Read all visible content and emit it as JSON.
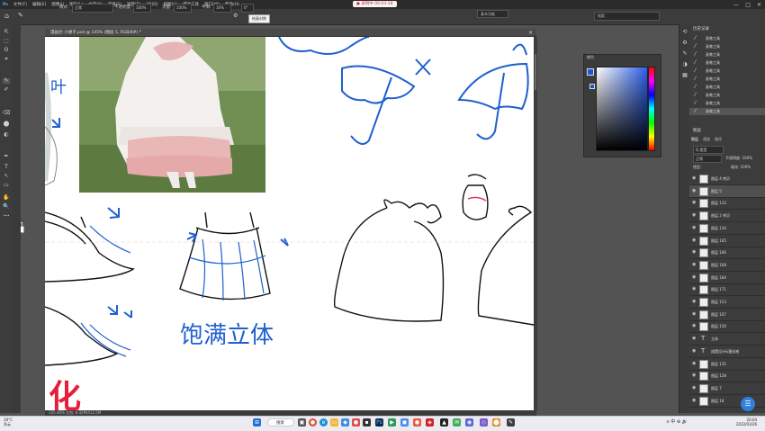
{
  "menu": {
    "items": [
      "文件(F)",
      "编辑(E)",
      "图像(I)",
      "图层(L)",
      "文字(Y)",
      "选择(S)",
      "滤镜(T)",
      "3D(D)",
      "视图(V)",
      "增效工具",
      "窗口(W)",
      "帮助(H)"
    ],
    "recording": "● 录制中 00:03:18",
    "win_controls": [
      "—",
      "□",
      "✕"
    ]
  },
  "options": {
    "mode_label": "模式:",
    "mode_value": "正常",
    "opacity_label": "不透明度:",
    "opacity_value": "100%",
    "flow_label": "流量:",
    "flow_value": "100%",
    "smooth_label": "平滑:",
    "smooth_value": "10%",
    "angle_value": "0°",
    "tooltip": "绘画对称",
    "workspace": "基本功能",
    "search": "搜索"
  },
  "toolbar": {
    "tools": [
      "⇱",
      "⬚",
      "ʘ",
      "⌗",
      "✎",
      "✐",
      "⌫",
      "⬤",
      "◐",
      "✒",
      "T",
      "↖",
      "▭",
      "✋",
      "🔍",
      "•••"
    ],
    "fg_color": "#1a55d6",
    "bg_color": "#ffffff"
  },
  "document": {
    "tab_title": "漫画社-小裙子.psd @ 145% (图层 5, RGB/8#) *",
    "status": "145.46%    文档: 8.42M/412.5M"
  },
  "canvas": {
    "caption": "饱满立体",
    "big_char": "化",
    "left_glyphs": "叶"
  },
  "picker": {
    "title": "颜色"
  },
  "history": {
    "title": "历史记录",
    "items": [
      "画笔工具",
      "画笔工具",
      "画笔工具",
      "画笔工具",
      "画笔工具",
      "画笔工具",
      "画笔工具",
      "画笔工具",
      "画笔工具",
      "画笔工具"
    ]
  },
  "layers": {
    "title": "图层",
    "tabs": [
      "图层",
      "通道",
      "路径"
    ],
    "filter_label": "Q 类型",
    "blend": "正常",
    "opacity": "不透明度: 100%",
    "lock": "锁定:",
    "fill": "填充: 100%",
    "rows": [
      {
        "name": "图层 4 拷贝",
        "kind": "img"
      },
      {
        "name": "图层 5",
        "kind": "img",
        "selected": true
      },
      {
        "name": "图层 133",
        "kind": "img"
      },
      {
        "name": "图层 2 拷贝",
        "kind": "img"
      },
      {
        "name": "图层 134",
        "kind": "img"
      },
      {
        "name": "图层 165",
        "kind": "img"
      },
      {
        "name": "图层 166",
        "kind": "img"
      },
      {
        "name": "图层 168",
        "kind": "img"
      },
      {
        "name": "图层 184",
        "kind": "img"
      },
      {
        "name": "图层 171",
        "kind": "img"
      },
      {
        "name": "图层 153",
        "kind": "img"
      },
      {
        "name": "图层 167",
        "kind": "img"
      },
      {
        "name": "图层 156",
        "kind": "img"
      },
      {
        "name": "立体",
        "kind": "text"
      },
      {
        "name": "裙摆设计&蓬松感",
        "kind": "text"
      },
      {
        "name": "图层 135",
        "kind": "img"
      },
      {
        "name": "图层 128",
        "kind": "img"
      },
      {
        "name": "图层 7",
        "kind": "img"
      },
      {
        "name": "图层 18",
        "kind": "img"
      }
    ]
  },
  "taskbar": {
    "search": "搜索",
    "weather_temp": "28°C",
    "weather_desc": "多云",
    "time": "20:04",
    "date": "2022/03/26",
    "tray": "∧  中  ⊕  🔊",
    "start_color": "#1f6fd6"
  }
}
